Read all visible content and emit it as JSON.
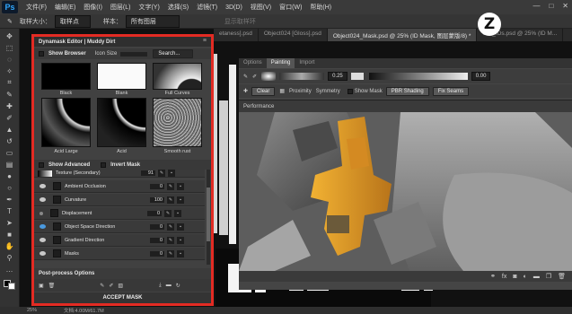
{
  "app": {
    "logo": "Ps",
    "menu": [
      "文件(F)",
      "编辑(E)",
      "图像(I)",
      "图层(L)",
      "文字(Y)",
      "选择(S)",
      "滤镜(T)",
      "3D(D)",
      "视图(V)",
      "窗口(W)",
      "帮助(H)"
    ],
    "window_controls": [
      "—",
      "□",
      "✕"
    ]
  },
  "options_bar": {
    "size_label": "取样大小：",
    "size_value": "取样点",
    "sample_label": "样本：",
    "sample_value": "所有图层",
    "show_ring": "显示取样环"
  },
  "doc_tabs": [
    {
      "label": "etaness].psd",
      "active": false
    },
    {
      "label": "Object024 [Gloss].psd",
      "active": false
    },
    {
      "label": "Object024_Mask.psd @ 25% (ID Mask, 图层蒙版/8) *",
      "active": true
    },
    {
      "label": "024_IDs.psd @ 25% (ID M...",
      "active": false
    }
  ],
  "dynamask": {
    "title": "Dynamask Editor  |  Muddy Dirt",
    "show_browser": "Show Browser",
    "icon_size": "Icon Size",
    "search": "Search...",
    "thumbs": [
      "Black",
      "Blank",
      "Full Curves",
      "Acid Large",
      "Acid",
      "Smooth rust"
    ],
    "show_advanced": "Show Advanced",
    "invert_mask": "Invert Mask",
    "layers": [
      {
        "name": "Texture (Secondary)",
        "value": "91"
      },
      {
        "name": "Ambient Occlusion",
        "value": "0"
      },
      {
        "name": "Curvature",
        "value": "100"
      },
      {
        "name": "Displacement",
        "value": "0"
      },
      {
        "name": "Object Space Direction",
        "value": "0"
      },
      {
        "name": "Gradient Direction",
        "value": "0"
      },
      {
        "name": "Masks",
        "value": "0"
      }
    ],
    "post_process": "Post-process Options",
    "accept": "ACCEPT MASK"
  },
  "painter": {
    "tabs": [
      "Options",
      "Painting",
      "Import"
    ],
    "active_tab": "Painting",
    "brush_size": "0.25",
    "opacity": "0.00",
    "clear": "Clear",
    "proximity": "Proximity",
    "symmetry": "Symmetry",
    "show_mask": "Show Mask",
    "shading": "PBR Shading",
    "fix_seams": "Fix Seams",
    "performance": "Performance"
  },
  "bottom_icons": [
    "link-icon",
    "fx-icon",
    "mask-icon",
    "adjust-icon",
    "folder-icon",
    "new-layer-icon",
    "trash-icon"
  ],
  "status": {
    "zoom": "25%",
    "doc": "文档:4.00M/61.7M"
  },
  "colors": {
    "accent_red": "#e32b23",
    "mech_orange": "#e8a02a",
    "panel_bg": "#414141"
  }
}
